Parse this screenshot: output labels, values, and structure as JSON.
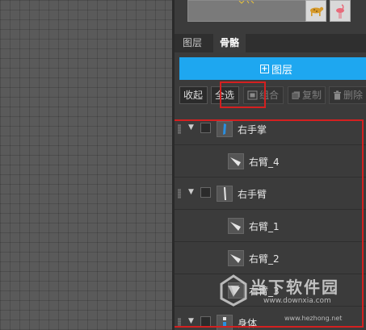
{
  "tabs": [
    {
      "label": "图层",
      "active": false
    },
    {
      "label": "骨骼",
      "active": true
    }
  ],
  "add_layer_label": "图层",
  "toolbar": {
    "collapse": "收起",
    "select_all": "全选",
    "group": "组合",
    "copy": "复制",
    "delete": "删除"
  },
  "layers": [
    {
      "name": "右手掌",
      "type": "group",
      "icon": "hand-icon"
    },
    {
      "name": "右臂_4",
      "type": "child",
      "icon": "arm-segment-icon"
    },
    {
      "name": "右手臂",
      "type": "group",
      "icon": "arm-icon"
    },
    {
      "name": "右臂_1",
      "type": "child",
      "icon": "arm-segment-icon"
    },
    {
      "name": "右臂_2",
      "type": "child",
      "icon": "arm-segment-icon"
    },
    {
      "name": "右臂_3",
      "type": "child",
      "icon": "arm-segment-icon"
    },
    {
      "name": "身体",
      "type": "group",
      "icon": "body-icon"
    }
  ],
  "watermark": {
    "line1": "当下软件园",
    "line2": "www.downxia.com",
    "line3": "www.hezhong.net"
  },
  "colors": {
    "accent": "#1ea7f0",
    "highlight_border": "#d42020",
    "panel_bg": "#3b3b3b",
    "canvas_bg": "#5a5a5a"
  }
}
